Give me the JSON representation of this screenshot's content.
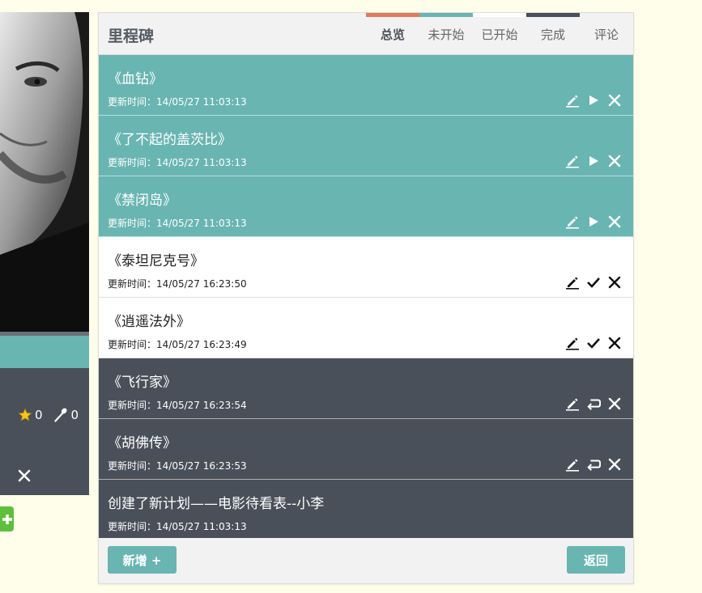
{
  "left_panel": {
    "stats": [
      {
        "icon": "star-icon",
        "value": "0"
      },
      {
        "icon": "spoon-icon",
        "value": "0"
      }
    ]
  },
  "header": {
    "title": "里程碑",
    "tabs": [
      {
        "label": "总览",
        "color": "#e07b5a",
        "active": true
      },
      {
        "label": "未开始",
        "color": "#69b5b2",
        "active": false
      },
      {
        "label": "已开始",
        "color": "#ffffff",
        "active": false
      },
      {
        "label": "完成",
        "color": "#4a5059",
        "active": false
      },
      {
        "label": "评论",
        "color": "",
        "active": false
      }
    ]
  },
  "time_prefix": "更新时间：",
  "items": [
    {
      "title": "《血钻》",
      "time": "14/05/27 11:03:13",
      "state": "teal"
    },
    {
      "title": "《了不起的盖茨比》",
      "time": "14/05/27 11:03:13",
      "state": "teal"
    },
    {
      "title": "《禁闭岛》",
      "time": "14/05/27 11:03:13",
      "state": "teal"
    },
    {
      "title": "《泰坦尼克号》",
      "time": "14/05/27 16:23:50",
      "state": "white"
    },
    {
      "title": "《逍遥法外》",
      "time": "14/05/27 16:23:49",
      "state": "white"
    },
    {
      "title": "《飞行家》",
      "time": "14/05/27 16:23:54",
      "state": "dark"
    },
    {
      "title": "《胡佛传》",
      "time": "14/05/27 16:23:53",
      "state": "dark"
    },
    {
      "title": "创建了新计划——电影待看表--小李",
      "time": "14/05/27 11:03:13",
      "state": "dark"
    }
  ],
  "footer": {
    "add_label": "新增 +",
    "back_label": "返回"
  },
  "colors": {
    "teal": "#69b5b2",
    "dark": "#4a5059",
    "accent_orange": "#e07b5a"
  }
}
